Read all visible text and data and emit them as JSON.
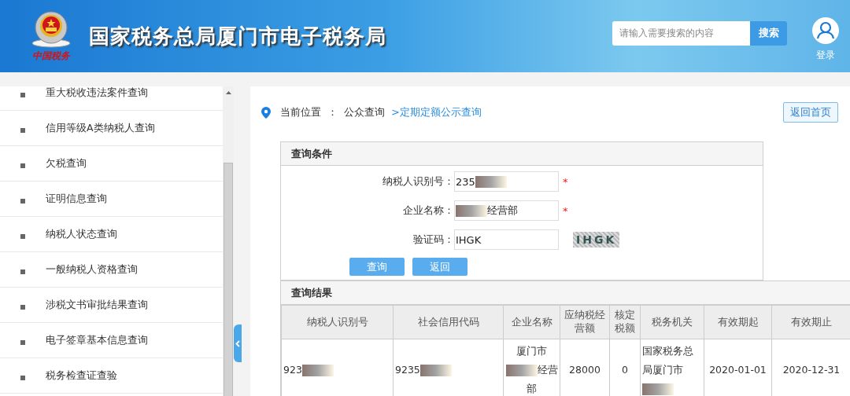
{
  "header": {
    "emblem_caption": "中国税务",
    "title": "国家税务总局厦门市电子税务局",
    "search": {
      "placeholder": "请输入需要搜索的内容",
      "button": "搜索"
    },
    "login": "登录"
  },
  "sidebar": {
    "items": [
      {
        "label": "重大税收违法案件查询"
      },
      {
        "label": "信用等级A类纳税人查询"
      },
      {
        "label": "欠税查询"
      },
      {
        "label": "证明信息查询"
      },
      {
        "label": "纳税人状态查询"
      },
      {
        "label": "一般纳税人资格查询"
      },
      {
        "label": "涉税文书审批结果查询"
      },
      {
        "label": "电子签章基本信息查询"
      },
      {
        "label": "税务检查证查验"
      }
    ]
  },
  "breadcrumb": {
    "label": "当前位置",
    "separator": "：",
    "parent": "公众查询",
    "current": ">定期定额公示查询"
  },
  "home_button": "返回首页",
  "query": {
    "title": "查询条件",
    "fields": [
      {
        "label": "纳税人识别号：",
        "required": true,
        "value": [
          {
            "kind": "text",
            "text": "235"
          },
          {
            "kind": "redaction"
          }
        ]
      },
      {
        "label": "企业名称：",
        "required": true,
        "value": [
          {
            "kind": "redaction"
          },
          {
            "kind": "text",
            "text": "经营部"
          }
        ]
      },
      {
        "label": "验证码：",
        "required": false,
        "value": [
          {
            "kind": "text",
            "text": "IHGK"
          }
        ],
        "captcha": "IHGK"
      }
    ],
    "buttons": [
      "查询",
      "返回"
    ],
    "required_mark": "*"
  },
  "results": {
    "title": "查询结果",
    "columns": [
      "纳税人识别号",
      "社会信用代码",
      "企业名称",
      "应纳税经营额",
      "核定税额",
      "税务机关",
      "有效期起",
      "有效期止"
    ],
    "rows": [
      [
        [
          {
            "kind": "text",
            "text": "923"
          },
          {
            "kind": "redaction"
          }
        ],
        [
          {
            "kind": "text",
            "text": "9235"
          },
          {
            "kind": "redaction"
          }
        ],
        [
          {
            "kind": "text",
            "text": "厦门市"
          },
          {
            "kind": "redaction"
          },
          {
            "kind": "text",
            "text": "经营部"
          }
        ],
        [
          {
            "kind": "text",
            "text": "28000"
          }
        ],
        [
          {
            "kind": "text",
            "text": "0"
          }
        ],
        [
          {
            "kind": "text",
            "text": "国家税务总局厦门市"
          },
          {
            "kind": "redaction"
          }
        ],
        [
          {
            "kind": "text",
            "text": "2020-01-01"
          }
        ],
        [
          {
            "kind": "text",
            "text": "2020-12-31"
          }
        ]
      ]
    ]
  }
}
